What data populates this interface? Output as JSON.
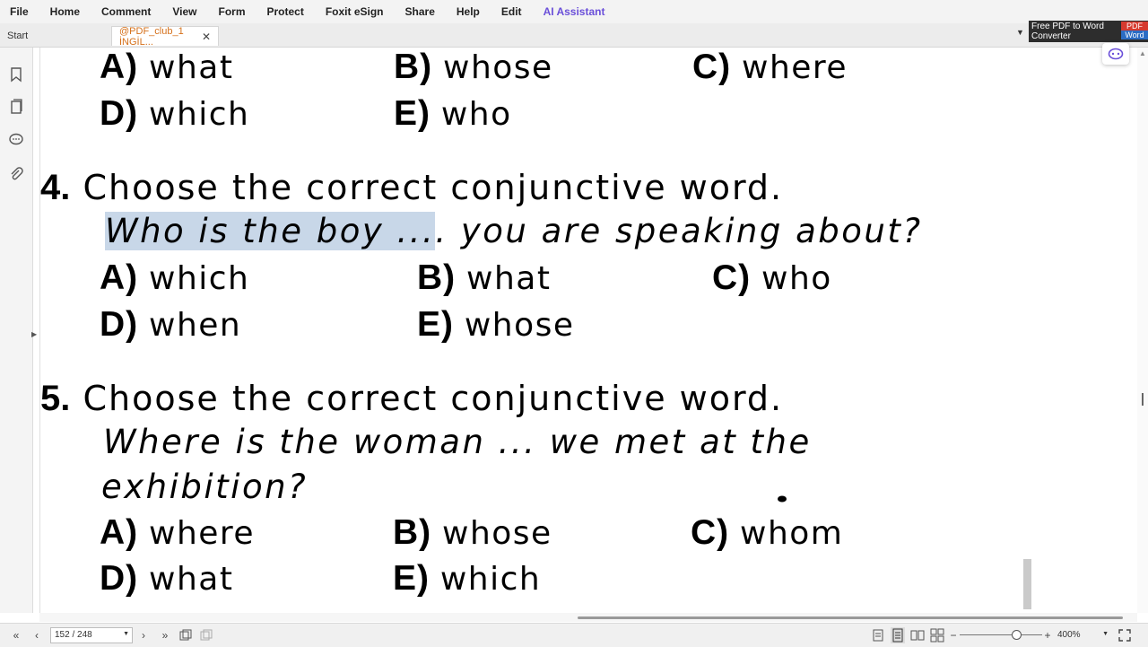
{
  "menu": [
    "File",
    "Home",
    "Comment",
    "View",
    "Form",
    "Protect",
    "Foxit eSign",
    "Share",
    "Help",
    "Edit",
    "AI Assistant"
  ],
  "tabs": {
    "start": "Start",
    "doc": "@PDF_club_1 İNGİL..."
  },
  "promo": {
    "line1": "Free PDF to Word",
    "line2": "Converter",
    "badge1": "PDF",
    "badge2": "Word"
  },
  "doc": {
    "prev_options": [
      {
        "letter": "A)",
        "word": "what"
      },
      {
        "letter": "B)",
        "word": "whose"
      },
      {
        "letter": "C)",
        "word": "where"
      },
      {
        "letter": "D)",
        "word": "which"
      },
      {
        "letter": "E)",
        "word": "who"
      }
    ],
    "q4": {
      "num": "4.",
      "prompt": "Choose the correct conjunctive word.",
      "sentence_selected": "Who is the boy ...",
      "sentence_rest": ". you are speaking about?",
      "options": [
        {
          "letter": "A)",
          "word": "which"
        },
        {
          "letter": "B)",
          "word": "what"
        },
        {
          "letter": "C)",
          "word": "who"
        },
        {
          "letter": "D)",
          "word": "when"
        },
        {
          "letter": "E)",
          "word": "whose"
        }
      ]
    },
    "q5": {
      "num": "5.",
      "prompt": "Choose the correct conjunctive word.",
      "sentence_line1": "Where is the woman ... we met at the",
      "sentence_line2": "exhibition?",
      "options": [
        {
          "letter": "A)",
          "word": "where"
        },
        {
          "letter": "B)",
          "word": "whose"
        },
        {
          "letter": "C)",
          "word": "whom"
        },
        {
          "letter": "D)",
          "word": "what"
        },
        {
          "letter": "E)",
          "word": "which"
        }
      ]
    }
  },
  "status": {
    "page": "152 / 248",
    "zoom": "400%"
  },
  "colors": {
    "accent_tab": "#d5701a",
    "ai_menu": "#6a4fd9",
    "selection": "#c8d7e8"
  },
  "icons": [
    "bookmark-icon",
    "pages-icon",
    "comment-icon",
    "attachment-icon",
    "first-page-icon",
    "prev-page-icon",
    "next-page-icon",
    "last-page-icon",
    "single-page-icon",
    "continuous-icon",
    "facing-icon",
    "zoom-out-icon",
    "zoom-in-icon",
    "fit-icon"
  ]
}
